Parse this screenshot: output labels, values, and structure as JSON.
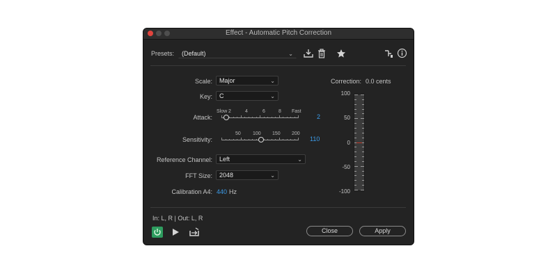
{
  "window": {
    "title": "Effect - Automatic Pitch Correction"
  },
  "presets": {
    "label": "Presets:",
    "value": "(Default)"
  },
  "scale": {
    "label": "Scale:",
    "value": "Major"
  },
  "key": {
    "label": "Key:",
    "value": "C"
  },
  "attack": {
    "label": "Attack:",
    "ticks": [
      "Slow",
      "2",
      "4",
      "6",
      "8",
      "Fast"
    ],
    "value": "2",
    "position": 0.06
  },
  "sensitivity": {
    "label": "Sensitivity:",
    "ticks": [
      "50",
      "100",
      "150",
      "200"
    ],
    "value": "110",
    "position": 0.52
  },
  "reference_channel": {
    "label": "Reference Channel:",
    "value": "Left"
  },
  "fft_size": {
    "label": "FFT Size:",
    "value": "2048"
  },
  "calibration": {
    "label": "Calibration A4:",
    "value": "440",
    "unit": "Hz"
  },
  "correction": {
    "label": "Correction:",
    "value": "0.0 cents",
    "scale_labels": [
      "100",
      "50",
      "0",
      "-50",
      "-100"
    ]
  },
  "io": {
    "text": "In: L, R | Out: L, R"
  },
  "buttons": {
    "close": "Close",
    "apply": "Apply"
  },
  "icons": {
    "save_preset": "download-icon",
    "delete_preset": "trash-icon",
    "favorite": "star-icon",
    "routing": "routing-icon",
    "info": "info-icon",
    "power": "power-icon",
    "play": "play-icon",
    "loop": "loop-icon"
  },
  "colors": {
    "accent": "#3c9be8",
    "power": "#2e9c5f",
    "meter_marker": "#c0392b"
  }
}
